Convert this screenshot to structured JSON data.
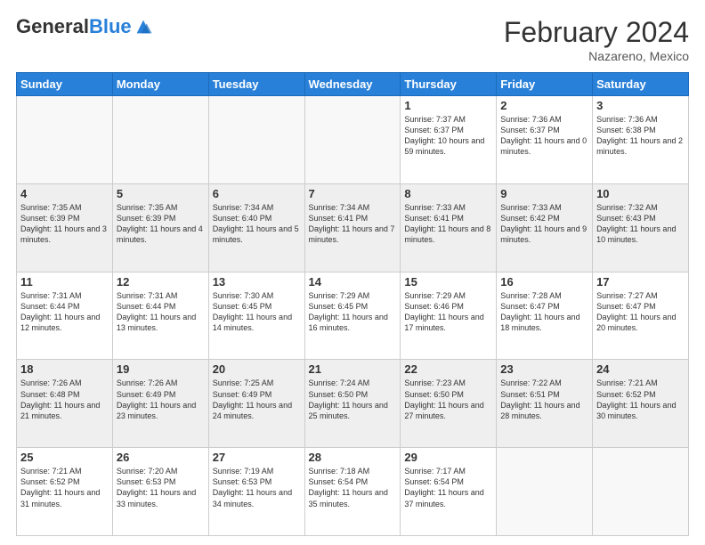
{
  "header": {
    "logo_general": "General",
    "logo_blue": "Blue",
    "month_title": "February 2024",
    "location": "Nazareno, Mexico"
  },
  "days_of_week": [
    "Sunday",
    "Monday",
    "Tuesday",
    "Wednesday",
    "Thursday",
    "Friday",
    "Saturday"
  ],
  "weeks": [
    {
      "days": [
        {
          "num": "",
          "info": ""
        },
        {
          "num": "",
          "info": ""
        },
        {
          "num": "",
          "info": ""
        },
        {
          "num": "",
          "info": ""
        },
        {
          "num": "1",
          "info": "Sunrise: 7:37 AM\nSunset: 6:37 PM\nDaylight: 10 hours\nand 59 minutes."
        },
        {
          "num": "2",
          "info": "Sunrise: 7:36 AM\nSunset: 6:37 PM\nDaylight: 11 hours\nand 0 minutes."
        },
        {
          "num": "3",
          "info": "Sunrise: 7:36 AM\nSunset: 6:38 PM\nDaylight: 11 hours\nand 2 minutes."
        }
      ]
    },
    {
      "days": [
        {
          "num": "4",
          "info": "Sunrise: 7:35 AM\nSunset: 6:39 PM\nDaylight: 11 hours\nand 3 minutes."
        },
        {
          "num": "5",
          "info": "Sunrise: 7:35 AM\nSunset: 6:39 PM\nDaylight: 11 hours\nand 4 minutes."
        },
        {
          "num": "6",
          "info": "Sunrise: 7:34 AM\nSunset: 6:40 PM\nDaylight: 11 hours\nand 5 minutes."
        },
        {
          "num": "7",
          "info": "Sunrise: 7:34 AM\nSunset: 6:41 PM\nDaylight: 11 hours\nand 7 minutes."
        },
        {
          "num": "8",
          "info": "Sunrise: 7:33 AM\nSunset: 6:41 PM\nDaylight: 11 hours\nand 8 minutes."
        },
        {
          "num": "9",
          "info": "Sunrise: 7:33 AM\nSunset: 6:42 PM\nDaylight: 11 hours\nand 9 minutes."
        },
        {
          "num": "10",
          "info": "Sunrise: 7:32 AM\nSunset: 6:43 PM\nDaylight: 11 hours\nand 10 minutes."
        }
      ]
    },
    {
      "days": [
        {
          "num": "11",
          "info": "Sunrise: 7:31 AM\nSunset: 6:44 PM\nDaylight: 11 hours\nand 12 minutes."
        },
        {
          "num": "12",
          "info": "Sunrise: 7:31 AM\nSunset: 6:44 PM\nDaylight: 11 hours\nand 13 minutes."
        },
        {
          "num": "13",
          "info": "Sunrise: 7:30 AM\nSunset: 6:45 PM\nDaylight: 11 hours\nand 14 minutes."
        },
        {
          "num": "14",
          "info": "Sunrise: 7:29 AM\nSunset: 6:45 PM\nDaylight: 11 hours\nand 16 minutes."
        },
        {
          "num": "15",
          "info": "Sunrise: 7:29 AM\nSunset: 6:46 PM\nDaylight: 11 hours\nand 17 minutes."
        },
        {
          "num": "16",
          "info": "Sunrise: 7:28 AM\nSunset: 6:47 PM\nDaylight: 11 hours\nand 18 minutes."
        },
        {
          "num": "17",
          "info": "Sunrise: 7:27 AM\nSunset: 6:47 PM\nDaylight: 11 hours\nand 20 minutes."
        }
      ]
    },
    {
      "days": [
        {
          "num": "18",
          "info": "Sunrise: 7:26 AM\nSunset: 6:48 PM\nDaylight: 11 hours\nand 21 minutes."
        },
        {
          "num": "19",
          "info": "Sunrise: 7:26 AM\nSunset: 6:49 PM\nDaylight: 11 hours\nand 23 minutes."
        },
        {
          "num": "20",
          "info": "Sunrise: 7:25 AM\nSunset: 6:49 PM\nDaylight: 11 hours\nand 24 minutes."
        },
        {
          "num": "21",
          "info": "Sunrise: 7:24 AM\nSunset: 6:50 PM\nDaylight: 11 hours\nand 25 minutes."
        },
        {
          "num": "22",
          "info": "Sunrise: 7:23 AM\nSunset: 6:50 PM\nDaylight: 11 hours\nand 27 minutes."
        },
        {
          "num": "23",
          "info": "Sunrise: 7:22 AM\nSunset: 6:51 PM\nDaylight: 11 hours\nand 28 minutes."
        },
        {
          "num": "24",
          "info": "Sunrise: 7:21 AM\nSunset: 6:52 PM\nDaylight: 11 hours\nand 30 minutes."
        }
      ]
    },
    {
      "days": [
        {
          "num": "25",
          "info": "Sunrise: 7:21 AM\nSunset: 6:52 PM\nDaylight: 11 hours\nand 31 minutes."
        },
        {
          "num": "26",
          "info": "Sunrise: 7:20 AM\nSunset: 6:53 PM\nDaylight: 11 hours\nand 33 minutes."
        },
        {
          "num": "27",
          "info": "Sunrise: 7:19 AM\nSunset: 6:53 PM\nDaylight: 11 hours\nand 34 minutes."
        },
        {
          "num": "28",
          "info": "Sunrise: 7:18 AM\nSunset: 6:54 PM\nDaylight: 11 hours\nand 35 minutes."
        },
        {
          "num": "29",
          "info": "Sunrise: 7:17 AM\nSunset: 6:54 PM\nDaylight: 11 hours\nand 37 minutes."
        },
        {
          "num": "",
          "info": ""
        },
        {
          "num": "",
          "info": ""
        }
      ]
    }
  ]
}
